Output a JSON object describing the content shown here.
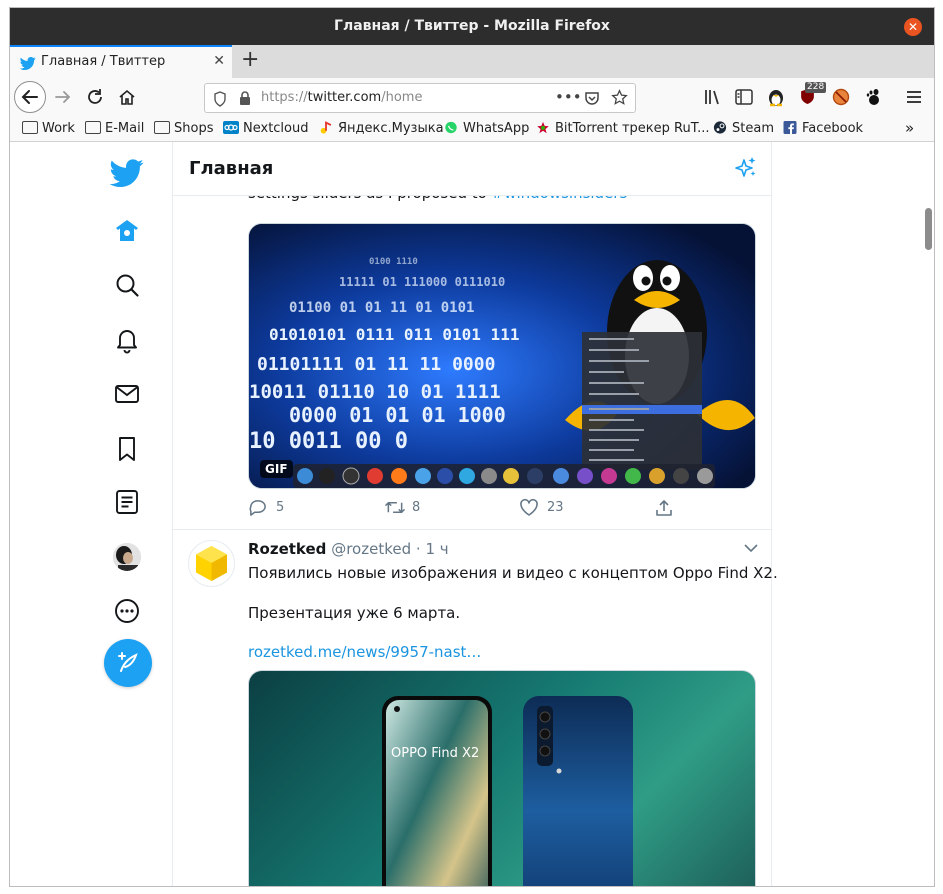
{
  "window": {
    "title": "Главная / Твиттер - Mozilla Firefox"
  },
  "tab": {
    "label": "Главная / Твиттер"
  },
  "url": {
    "prefix": "https://",
    "host": "twitter.com",
    "path": "/home"
  },
  "toolbar": {
    "badge_count": "228"
  },
  "bookmarks": [
    {
      "label": "Work",
      "icon": "folder-icon"
    },
    {
      "label": "E-Mail",
      "icon": "folder-icon"
    },
    {
      "label": "Shops",
      "icon": "folder-icon"
    },
    {
      "label": "Nextcloud",
      "icon": "nextcloud-icon"
    },
    {
      "label": "Яндекс.Музыка",
      "icon": "yandex-music-icon"
    },
    {
      "label": "WhatsApp",
      "icon": "whatsapp-icon"
    },
    {
      "label": "BitTorrent трекер RuT...",
      "icon": "rutracker-icon"
    },
    {
      "label": "Steam",
      "icon": "steam-icon"
    },
    {
      "label": "Facebook",
      "icon": "facebook-icon"
    }
  ],
  "timeline": {
    "header": "Главная",
    "prev_tweet": {
      "text": "settings sliders as I proposed to ",
      "hashtag": "#windowsinsiders",
      "gif_label": "GIF",
      "binary_rows": [
        "0100 1110",
        "11111 01 111000 0111010",
        "01100 01 01 11 01 0101",
        "01010101 0111 011 0101 111",
        "01101111 01 11 11 0000",
        "10011 01110 10 01 1111",
        "0000 01 01 01 1000",
        "10 0011 00 0"
      ],
      "replies": "5",
      "retweets": "8",
      "likes": "23"
    },
    "tweet": {
      "name": "Rozetked",
      "handle": "@rozetked",
      "dot": "·",
      "time": "1 ч",
      "line1": "Появились новые изображения и видео с концептом Oppo Find X2.",
      "line2": "Презентация уже 6 марта.",
      "link": "rozetked.me/news/9957-nast…",
      "image_caption": "OPPO Find X2"
    }
  },
  "colors": {
    "twitter_blue": "#1da1f2",
    "link": "#1b95e0",
    "ubuntu_orange": "#e95420"
  }
}
